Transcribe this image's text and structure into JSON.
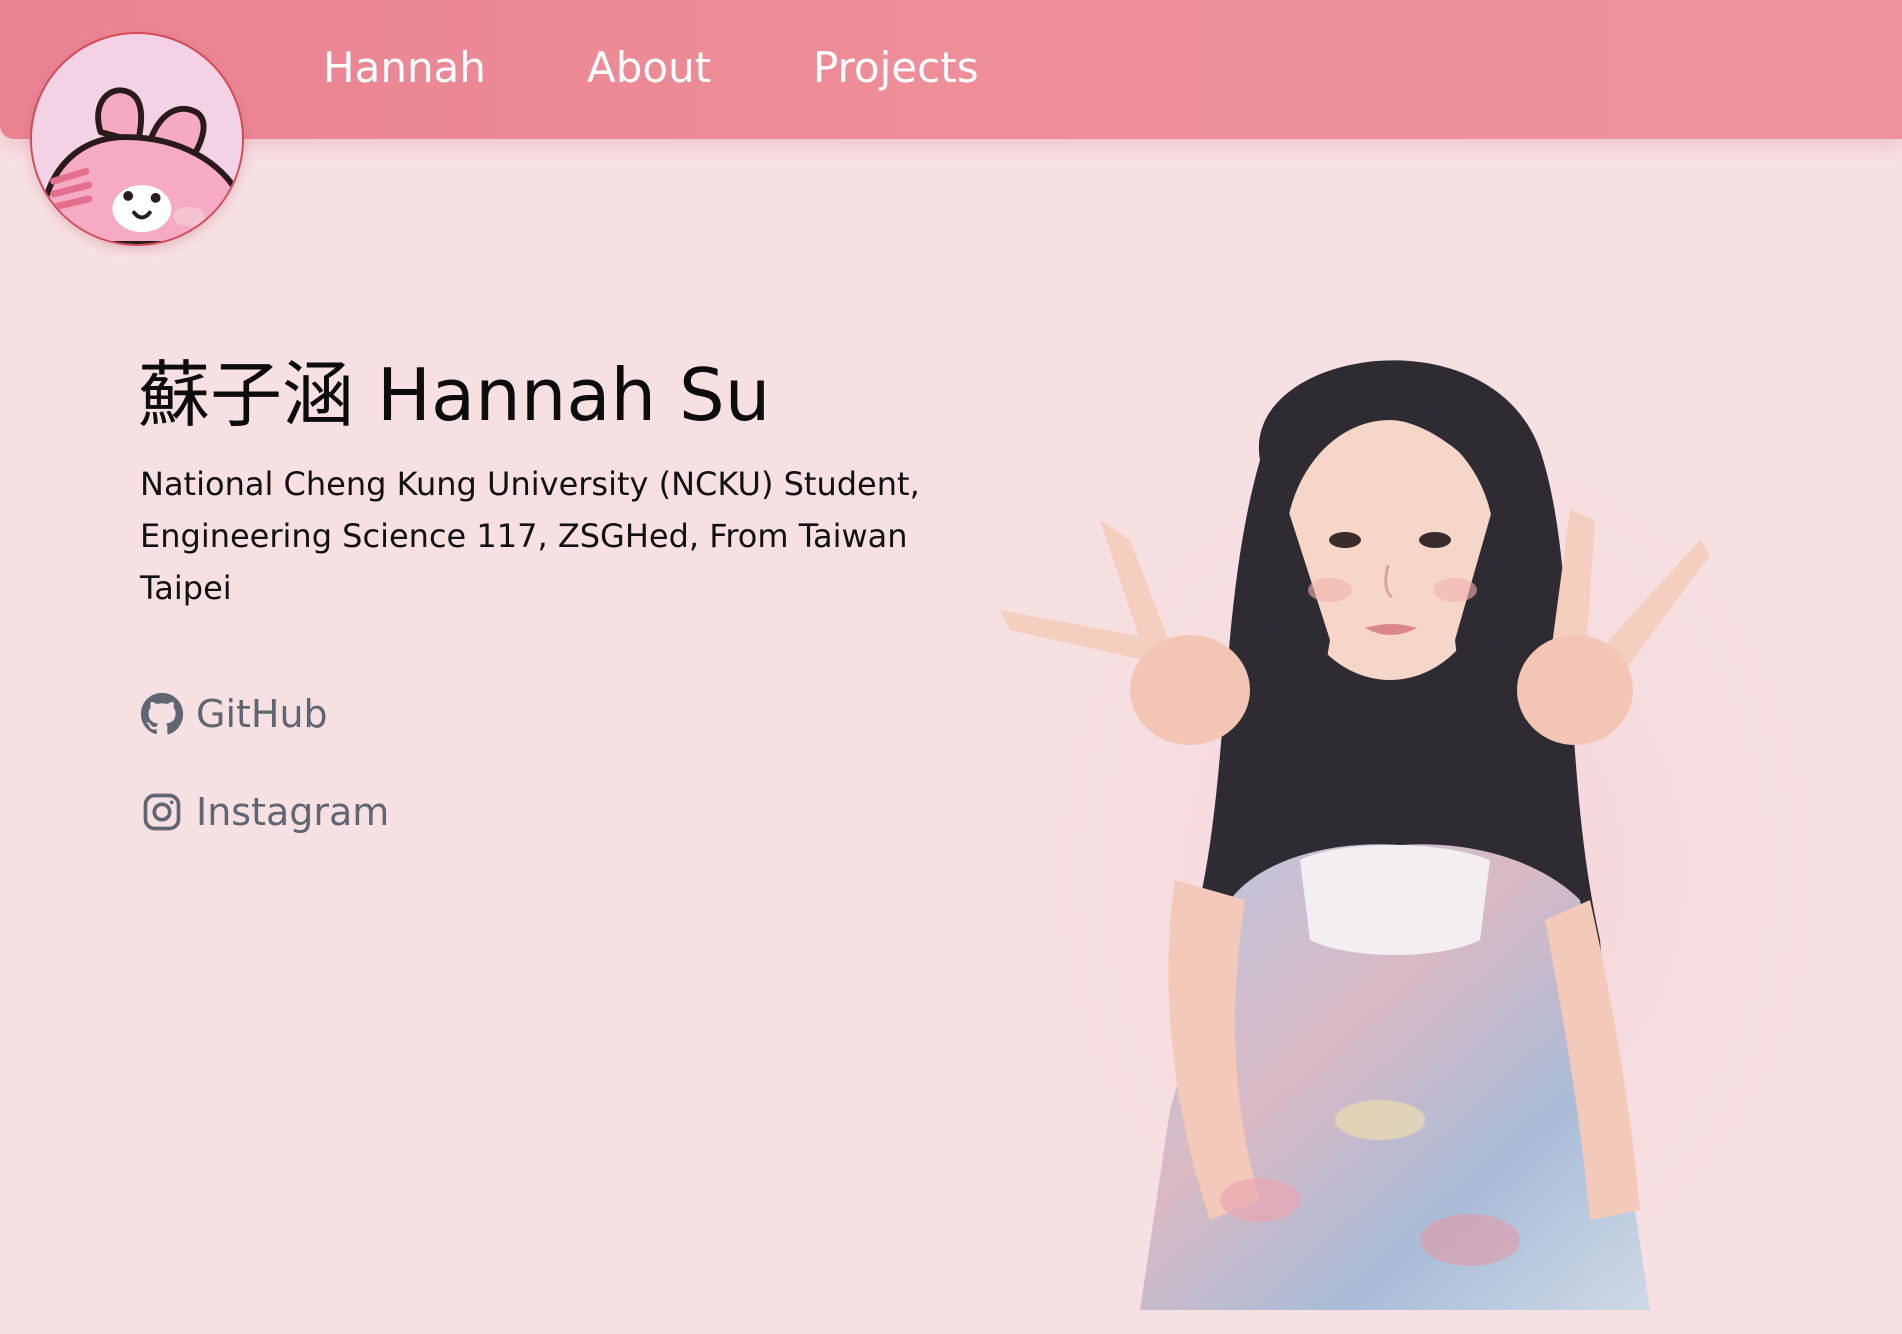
{
  "nav": {
    "items": [
      {
        "label": "Hannah"
      },
      {
        "label": "About"
      },
      {
        "label": "Projects"
      }
    ]
  },
  "profile": {
    "name": "蘇子涵 Hannah Su",
    "bio": {
      "line1": "National Cheng Kung University (NCKU) Student,",
      "line2": "Engineering Science 117, ZSGHed, From Taiwan",
      "line3": "Taipei"
    }
  },
  "social": {
    "github": {
      "label": "GitHub",
      "icon": "github-icon"
    },
    "instagram": {
      "label": "Instagram",
      "icon": "instagram-icon"
    }
  },
  "colors": {
    "page_bg": "#f7e0e2",
    "nav_bg": "#ec8a96",
    "nav_text": "#ffffff",
    "link_text": "#5f6672",
    "avatar_border": "#d24a58"
  }
}
